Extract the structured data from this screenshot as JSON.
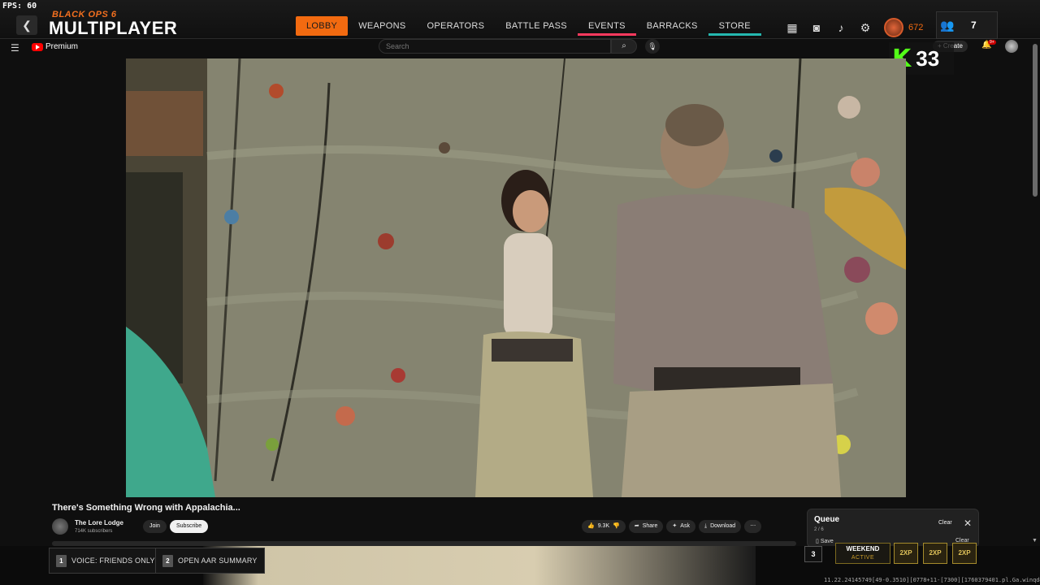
{
  "game": {
    "fps": "FPS:  60",
    "logo_sub": "BLACK OPS 6",
    "logo_main": "MULTIPLAYER",
    "nav": [
      "LOBBY",
      "WEAPONS",
      "OPERATORS",
      "BATTLE PASS",
      "EVENTS",
      "BARRACKS",
      "STORE"
    ],
    "currency": "672",
    "party_count": "7"
  },
  "youtube": {
    "brand": "Premium",
    "search_placeholder": "Search",
    "create_label": "Create",
    "notif_badge": "9+",
    "video_title": "There's Something Wrong with Appalachia...",
    "channel_name": "The Lore Lodge",
    "channel_subs": "714K subscribers",
    "join_label": "Join",
    "subscribe_label": "Subscribe",
    "likes": "9.3K",
    "share_label": "Share",
    "ask_label": "Ask",
    "download_label": "Download",
    "queue": {
      "title": "Queue",
      "count": "2 / 6",
      "clear_label": "Clear",
      "save_label": "Save",
      "clear_label_2": "Clear"
    }
  },
  "killstreak": {
    "count": "33"
  },
  "hud": {
    "btn1_key": "1",
    "btn1_label": "VOICE: FRIENDS ONLY",
    "btn2_key": "2",
    "btn2_label": "OPEN AAR SUMMARY",
    "key3": "3",
    "weekend_title": "WEEKEND",
    "weekend_status": "ACTIVE",
    "xp_labels": [
      "2XP",
      "2XP",
      "2XP"
    ],
    "build": "11.22.24145749[49-0.3510][0778+11-[7300][1760379401.pl.Ga.winqd#"
  },
  "colors": {
    "accent": "#f26a10",
    "yt_red": "#ff0000",
    "kick_green": "#53fc18"
  }
}
